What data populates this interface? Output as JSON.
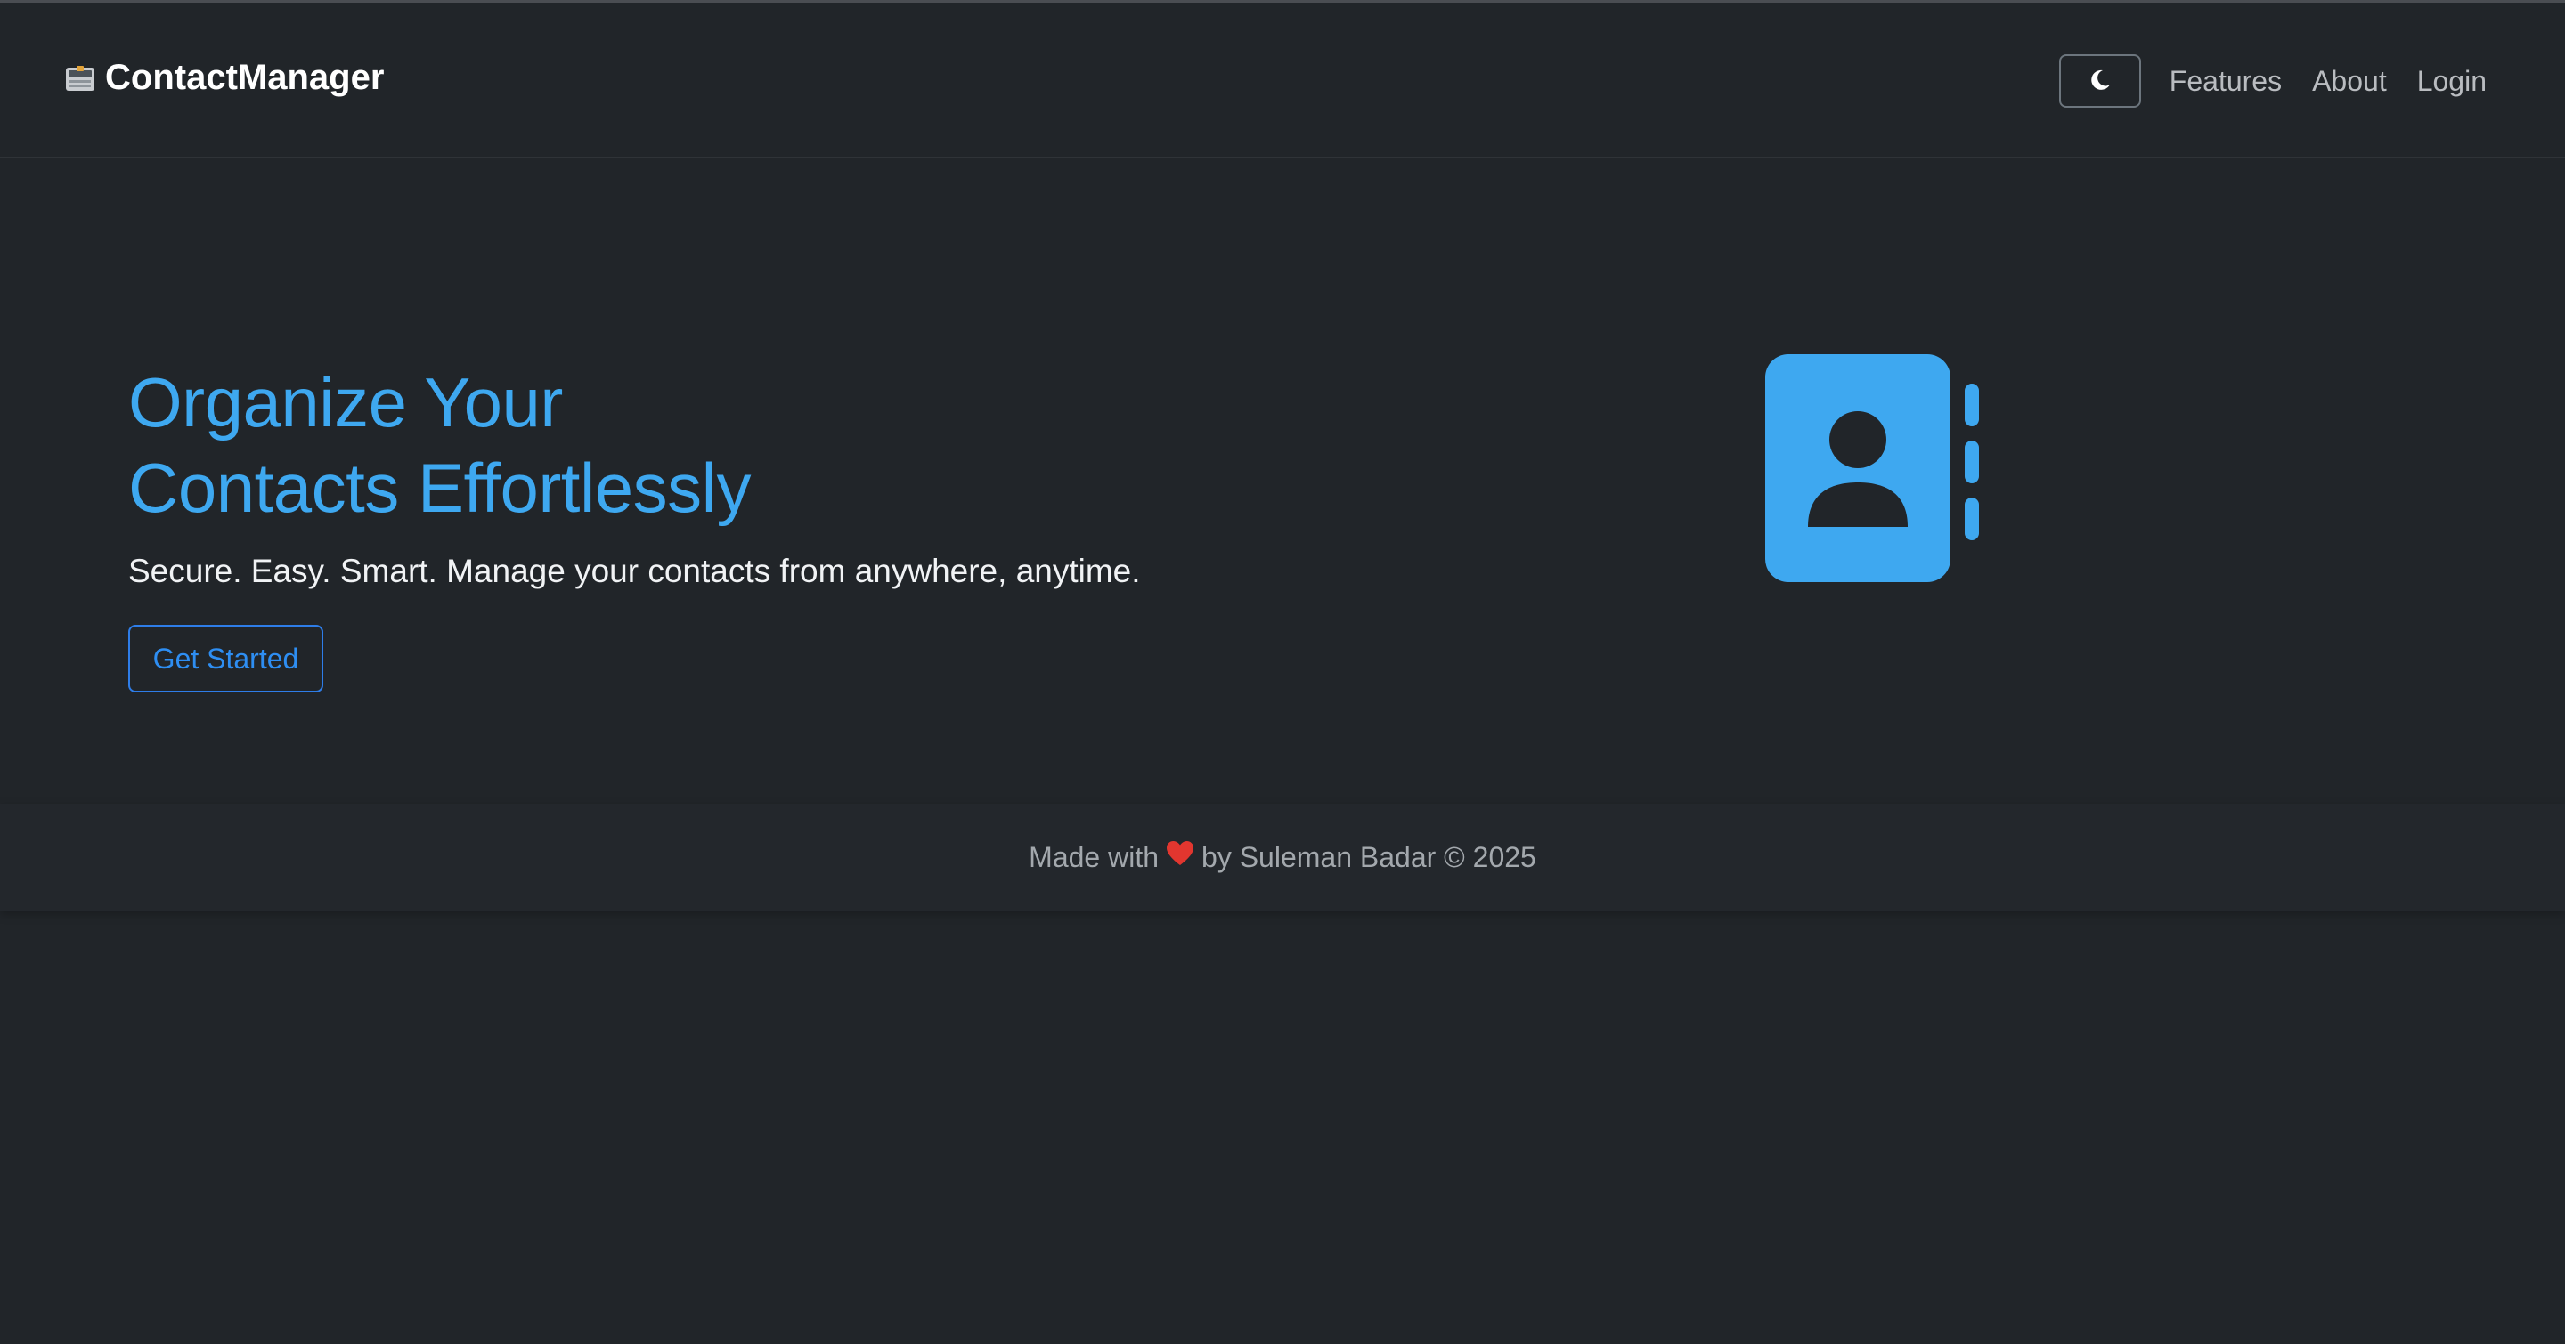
{
  "navbar": {
    "brand": "ContactManager",
    "brand_icon": "card-index-icon",
    "theme_toggle_icon": "moon-icon",
    "links": [
      "Features",
      "About",
      "Login"
    ]
  },
  "hero": {
    "title_line1": "Organize Your",
    "title_line2": "Contacts Effortlessly",
    "subtitle": "Secure. Easy. Smart. Manage your contacts from anywhere, anytime.",
    "cta_label": "Get Started",
    "illustration_icon": "contact-book-icon"
  },
  "footer": {
    "prefix": "Made with",
    "heart_icon": "heart-icon",
    "suffix": "by Suleman Badar © 2025"
  },
  "colors": {
    "background": "#212529",
    "accent": "#3ea8f0",
    "button_border": "#2e7de8",
    "footer_text": "#a3a8ad"
  }
}
